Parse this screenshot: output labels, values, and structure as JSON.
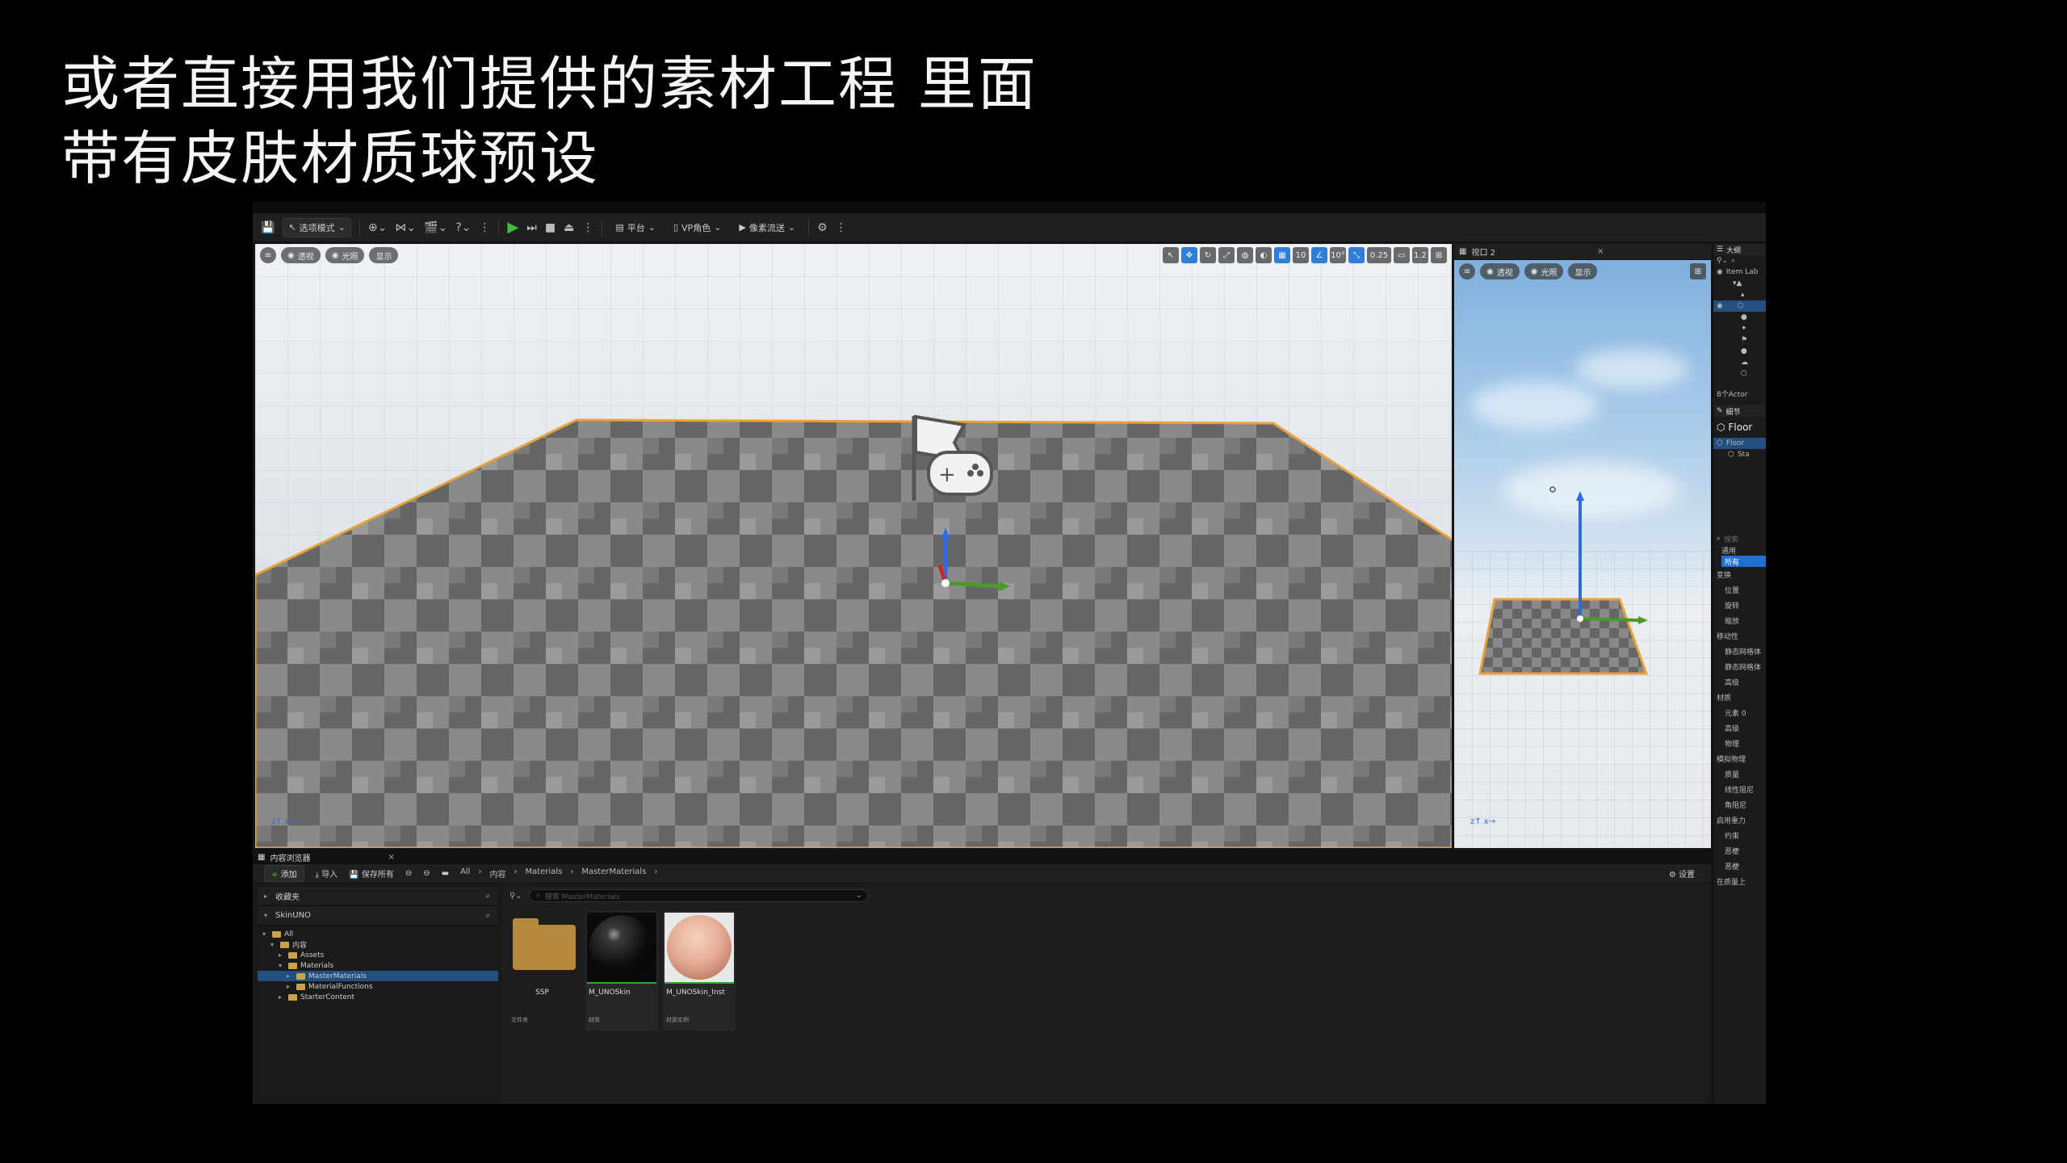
{
  "caption": {
    "line1": "或者直接用我们提供的素材工程 里面",
    "line2": "带有皮肤材质球预设"
  },
  "toolbar": {
    "mode_label": "选项模式",
    "platforms_label": "平台",
    "vp_label": "VP角色",
    "pixel_label": "像素流送"
  },
  "viewport_main": {
    "perspective_label": "透视",
    "lit_label": "光照",
    "show_label": "显示",
    "grid_snap": "10",
    "angle_snap": "10°",
    "scale_snap": "0.25",
    "camera_speed": "1.2"
  },
  "viewport_side": {
    "tab_label": "视口 2",
    "perspective_label": "透视",
    "lit_label": "光照",
    "show_label": "显示"
  },
  "outliner": {
    "title": "大纲",
    "item_label_header": "Item Lab",
    "actor_count": "8个Actor",
    "details_title": "细节",
    "selected_name": "Floor",
    "component_root": "Floor",
    "component_child": "Sta",
    "search_placeholder": "搜索",
    "filter_general": "通用",
    "filter_all": "所有",
    "sections": [
      "变换",
      "位置",
      "旋转",
      "缩放",
      "移动性",
      "静态网格体",
      "静态网格体",
      "高级",
      "材质",
      "元素 0",
      "高级",
      "物理",
      "模拟物理",
      "质量",
      "线性阻尼",
      "角阻尼",
      "启用重力",
      "约束",
      "恶梗",
      "恶梗",
      "在质量上"
    ]
  },
  "content_browser": {
    "tab_label": "内容浏览器",
    "add_label": "添加",
    "import_label": "导入",
    "save_all_label": "保存所有",
    "breadcrumb": [
      "All",
      "内容",
      "Materials",
      "MasterMaterials"
    ],
    "settings_label": "设置",
    "favorites_label": "收藏夹",
    "project_label": "SkinUNO",
    "search_placeholder": "搜索 MasterMaterials",
    "tree": [
      {
        "label": "All",
        "depth": 0
      },
      {
        "label": "内容",
        "depth": 1
      },
      {
        "label": "Assets",
        "depth": 2
      },
      {
        "label": "Materials",
        "depth": 2
      },
      {
        "label": "MasterMaterials",
        "depth": 3,
        "selected": true
      },
      {
        "label": "MaterialFunctions",
        "depth": 3
      },
      {
        "label": "StarterContent",
        "depth": 2
      }
    ],
    "assets": [
      {
        "name": "SSP",
        "type": "文件夹",
        "kind": "folder"
      },
      {
        "name": "M_UNOSkin",
        "type": "材质",
        "kind": "material"
      },
      {
        "name": "M_UNOSkin_Inst",
        "type": "材质实例",
        "kind": "instance"
      }
    ]
  }
}
